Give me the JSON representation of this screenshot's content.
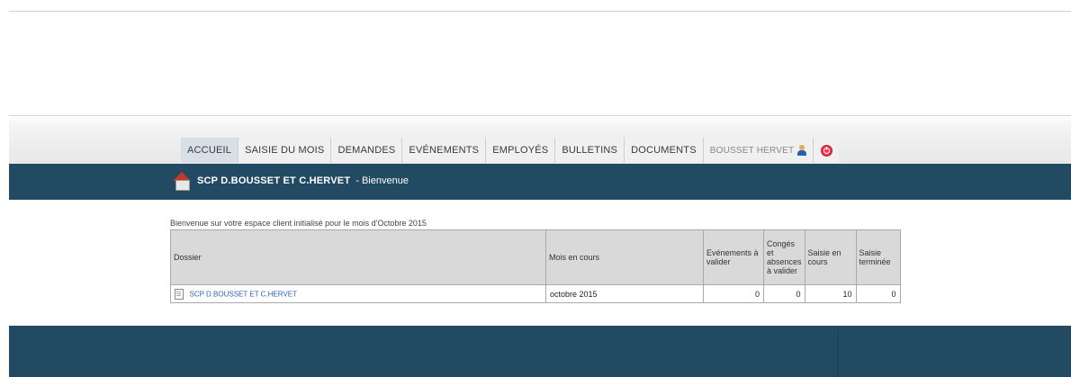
{
  "nav": {
    "items": [
      {
        "label": "ACCUEIL",
        "active": true
      },
      {
        "label": "SAISIE DU MOIS"
      },
      {
        "label": "DEMANDES"
      },
      {
        "label": "EVÉNEMENTS"
      },
      {
        "label": "EMPLOYÉS"
      },
      {
        "label": "BULLETINS"
      },
      {
        "label": "DOCUMENTS"
      }
    ],
    "user_label": "BOUSSET HERVET",
    "icons": {
      "user": "user-icon",
      "logout": "power-icon"
    }
  },
  "banner": {
    "company": "SCP D.BOUSSET ET C.HERVET",
    "suffix": "- Bienvenue",
    "icon": "house-icon"
  },
  "intro": "Bienvenue sur votre espace client initialisé pour le mois d'Octobre 2015",
  "table": {
    "headers": {
      "dossier": "Dossier",
      "mois": "Mois en cours",
      "evenements": "Evénements à valider",
      "conges": "Congés et absences à valider",
      "saisie_en_cours": "Saisie en cours",
      "saisie_terminee": "Saisie terminée"
    },
    "row": {
      "dossier": "SCP D.BOUSSET ET C.HERVET",
      "mois": "octobre 2015",
      "evenements": "0",
      "conges": "0",
      "saisie_en_cours": "10",
      "saisie_terminee": "0"
    }
  },
  "colors": {
    "banner": "#234a63",
    "link": "#3060c0",
    "active_tab": "#d9dfe6"
  }
}
